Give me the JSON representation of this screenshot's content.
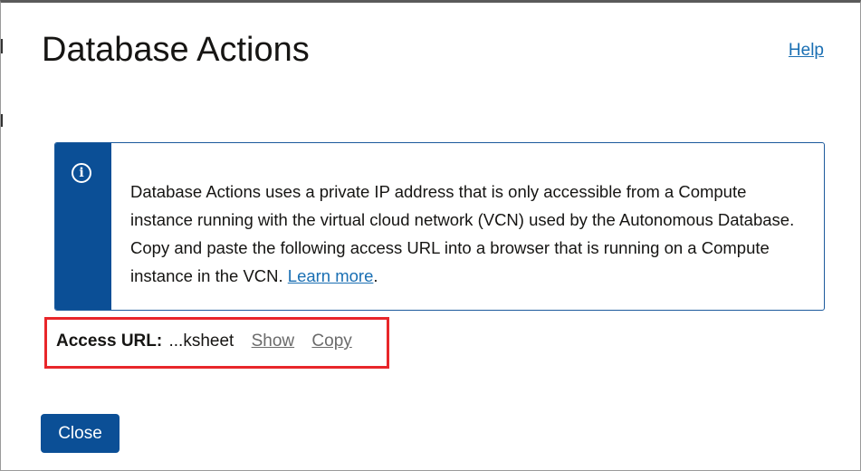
{
  "dialog": {
    "title": "Database Actions",
    "help_label": "Help"
  },
  "info": {
    "icon": "info-icon",
    "text": "Database Actions uses a private IP address that is only accessible from a Compute instance running with the virtual cloud network (VCN) used by the Autonomous Database. Copy and paste the following access URL into a browser that is running on a Compute instance in the VCN. ",
    "learn_more": "Learn more",
    "trailing": "."
  },
  "access": {
    "label": "Access URL:",
    "value": "...ksheet",
    "show_label": "Show",
    "copy_label": "Copy"
  },
  "footer": {
    "close_label": "Close"
  },
  "colors": {
    "accent": "#0b4f96",
    "link": "#1a6fb3",
    "highlight": "#e8262a"
  }
}
